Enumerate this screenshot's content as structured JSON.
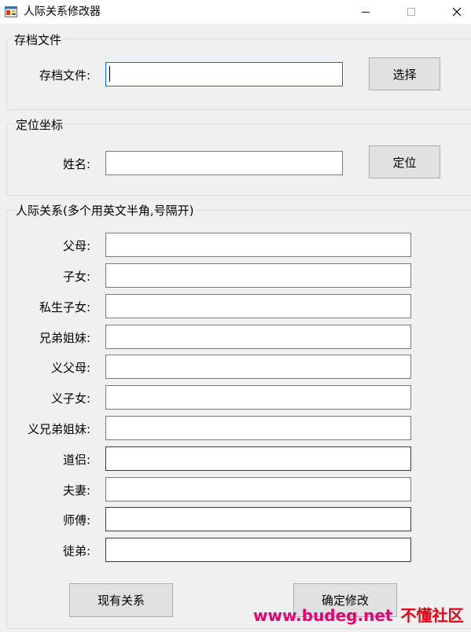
{
  "window": {
    "title": "人际关系修改器",
    "icon": "app-window-icon",
    "controls": [
      "minimize-icon",
      "maximize-icon",
      "close-icon"
    ]
  },
  "archive_group": {
    "title": "存档文件",
    "file_label": "存档文件:",
    "file_value": "",
    "select_button": "选择"
  },
  "locate_group": {
    "title": "定位坐标",
    "name_label": "姓名:",
    "name_value": "",
    "locate_button": "定位"
  },
  "relations_group": {
    "title": "人际关系(多个用英文半角,号隔开)",
    "fields": [
      {
        "label": "父母:",
        "value": ""
      },
      {
        "label": "子女:",
        "value": ""
      },
      {
        "label": "私生子女:",
        "value": ""
      },
      {
        "label": "兄弟姐妹:",
        "value": ""
      },
      {
        "label": "义父母:",
        "value": ""
      },
      {
        "label": "义子女:",
        "value": ""
      },
      {
        "label": "义兄弟姐妹:",
        "value": ""
      },
      {
        "label": "道侣:",
        "value": ""
      },
      {
        "label": "夫妻:",
        "value": ""
      },
      {
        "label": "师傅:",
        "value": ""
      },
      {
        "label": "徒弟:",
        "value": ""
      }
    ],
    "current_button": "现有关系",
    "confirm_button": "确定修改"
  },
  "watermark": {
    "site": "www.budeg.net",
    "brand": "不懂社区"
  },
  "colors": {
    "window_bg": "#f0f0f0",
    "focus_border": "#0078d7",
    "button_bg": "#e1e1e1",
    "watermark_pink": "#e6006e",
    "watermark_red": "#e60012"
  }
}
